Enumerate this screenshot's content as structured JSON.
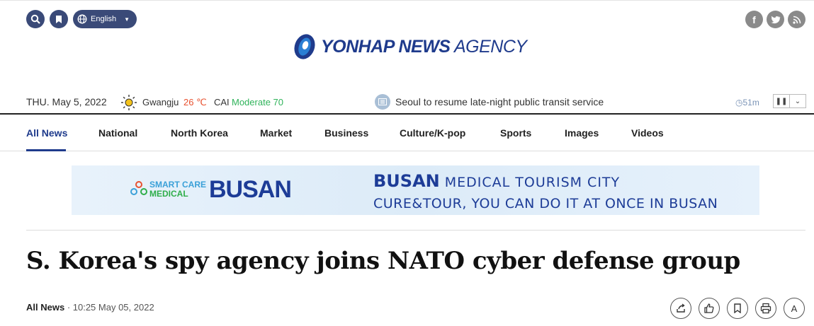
{
  "header": {
    "language": "English",
    "logo_text_bold": "YONHAP NEWS",
    "logo_text_light": " AGENCY",
    "social": [
      "facebook-icon",
      "twitter-icon",
      "rss-icon"
    ]
  },
  "infobar": {
    "date": "THU. May 5, 2022",
    "city": "Gwangju",
    "temp": "26 ℃",
    "cai_label": "CAI",
    "cai_value": "Moderate 70",
    "ticker": "Seoul to resume late-night public transit service",
    "ago": "51m"
  },
  "nav": {
    "items": [
      "All News",
      "National",
      "North Korea",
      "Market",
      "Business",
      "Culture/K-pop",
      "Sports",
      "Images",
      "Videos"
    ]
  },
  "banner": {
    "sc_line1": "SMART CARE",
    "sc_line2": "MEDICAL",
    "busan": "BUSAN",
    "line1_bold": "BUSAN",
    "line1_rest": " MEDICAL TOURISM CITY",
    "line2": "CURE&TOUR, YOU CAN DO IT AT ONCE IN BUSAN"
  },
  "article": {
    "headline": "S. Korea's spy agency joins NATO cyber defense group",
    "section": "All News",
    "timestamp": "· 10:25 May 05, 2022"
  },
  "tools": {
    "font_label": "A"
  },
  "colors": {
    "brand": "#1f3b8c",
    "temp": "#e8512f",
    "air_quality": "#2fb35a"
  }
}
